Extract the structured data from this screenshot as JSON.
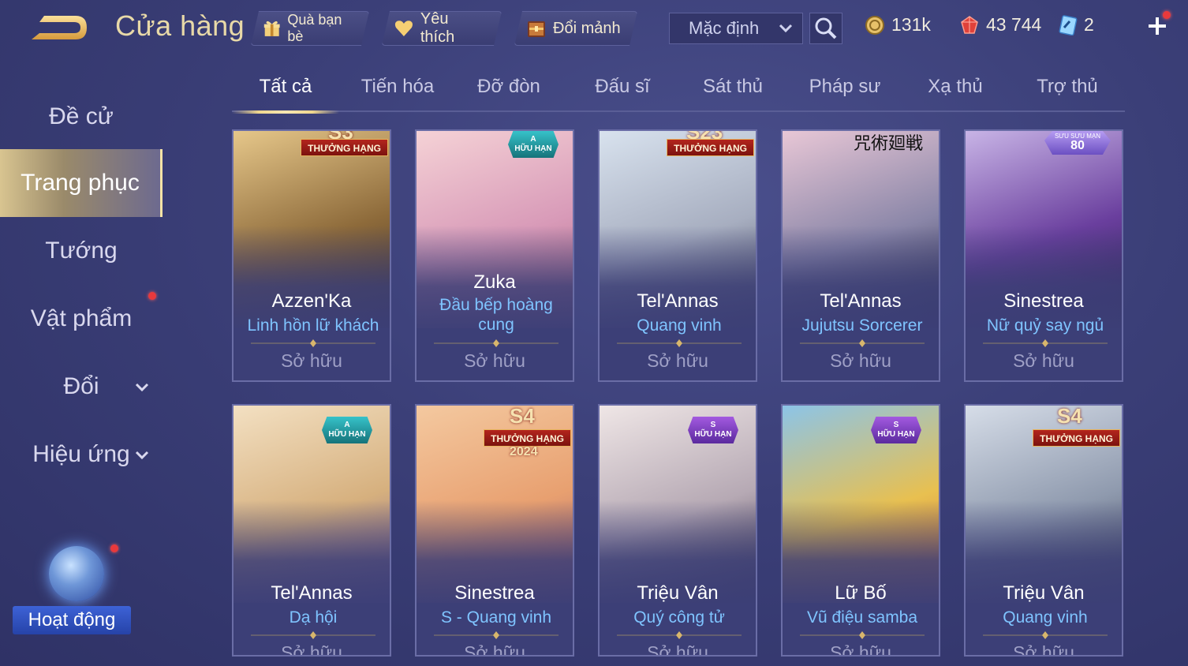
{
  "header": {
    "title": "Cửa hàng",
    "gift_label": "Quà bạn bè",
    "favorite_label": "Yêu thích",
    "fragment_label": "Đổi mảnh",
    "sort_value": "Mặc định",
    "gold": "131k",
    "ruby": "43 744",
    "voucher": "2"
  },
  "sidebar": {
    "items": [
      {
        "label": "Đề cử"
      },
      {
        "label": "Trang phục"
      },
      {
        "label": "Tướng"
      },
      {
        "label": "Vật phẩm"
      },
      {
        "label": "Đổi"
      },
      {
        "label": "Hiệu ứng"
      }
    ],
    "event_label": "Hoạt động"
  },
  "tabs": [
    "Tất cả",
    "Tiến hóa",
    "Đỡ đòn",
    "Đấu sĩ",
    "Sát thủ",
    "Pháp sư",
    "Xạ thủ",
    "Trợ thủ"
  ],
  "badges": {
    "rank": "THƯỞNG HẠNG",
    "limited": "HỮU HẠN",
    "grade_a": "A",
    "grade_s": "S",
    "season_s3": "S3",
    "season_s23": "S23",
    "season_s4": "S4",
    "year_2024": "2024",
    "collection_small": "SƯU SƯU MẠN",
    "collection_num": "80",
    "banner_text": "咒術廻戦"
  },
  "owned_label": "Sở hữu",
  "cards": [
    {
      "hero": "Azzen'Ka",
      "skin": "Linh hồn lữ khách",
      "colors": [
        "#e6c78a",
        "#8d6a3a",
        "#3d2e26"
      ]
    },
    {
      "hero": "Zuka",
      "skin": "Đầu bếp hoàng cung",
      "colors": [
        "#f5d2d6",
        "#d89ab8",
        "#b0677f"
      ]
    },
    {
      "hero": "Tel'Annas",
      "skin": "Quang vinh",
      "colors": [
        "#d8e2ee",
        "#a7aec0",
        "#4a4a5e"
      ]
    },
    {
      "hero": "Tel'Annas",
      "skin": "Jujutsu Sorcerer",
      "colors": [
        "#e8c7d6",
        "#8a86a8",
        "#2a2a44"
      ]
    },
    {
      "hero": "Sinestrea",
      "skin": "Nữ quỷ say ngủ",
      "colors": [
        "#c8b4e6",
        "#6a3f9e",
        "#2b1d4a"
      ]
    },
    {
      "hero": "Tel'Annas",
      "skin": "Dạ hội",
      "colors": [
        "#f3e0c2",
        "#d6b07e",
        "#7a5a8c"
      ]
    },
    {
      "hero": "Sinestrea",
      "skin": "S - Quang vinh",
      "colors": [
        "#f4c9a0",
        "#e8a070",
        "#9e5a6a"
      ]
    },
    {
      "hero": "Triệu Vân",
      "skin": "Quý công tử",
      "colors": [
        "#efe6e6",
        "#b6a9b4",
        "#3f3446"
      ]
    },
    {
      "hero": "Lữ Bố",
      "skin": "Vũ điệu samba",
      "colors": [
        "#8cc4e8",
        "#e8c050",
        "#d06a3a"
      ]
    },
    {
      "hero": "Triệu Vân",
      "skin": "Quang vinh",
      "colors": [
        "#d6dde8",
        "#8f9aae",
        "#3e4458"
      ]
    }
  ]
}
